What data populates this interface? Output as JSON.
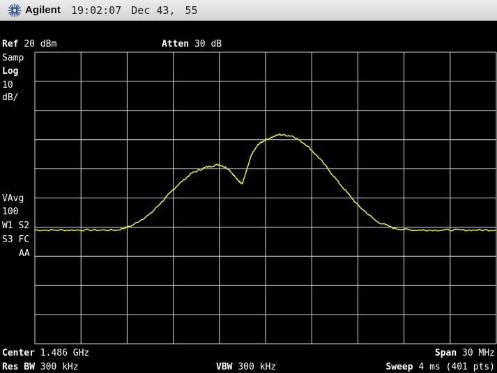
{
  "header": {
    "brand": "Agilent",
    "time": "19:02:07",
    "date": "Dec 43,",
    "extra": "55"
  },
  "display": {
    "ref_label": "Ref",
    "ref_value": "20 dBm",
    "atten_label": "Atten",
    "atten_value": "30 dB",
    "left_panel": {
      "mode": "Samp",
      "scale_type": "Log",
      "scale_value": "10",
      "scale_unit": "dB/",
      "avg_label": "VAvg",
      "avg_count": "100",
      "w1s2": "W1  S2",
      "s3fc": "S3  FC",
      "aa": "AA"
    },
    "center_label": "Center",
    "center_value": "1.486 GHz",
    "span_label": "Span",
    "span_value": "30 MHz",
    "rbw_label": "Res BW",
    "rbw_value": "300 kHz",
    "vbw_label": "VBW",
    "vbw_value": "300 kHz",
    "sweep_label": "Sweep",
    "sweep_value": "4 ms (401 pts)"
  },
  "colors": {
    "trace": "#e4e33a",
    "grid": "#d8d8d8",
    "background": "#000000"
  },
  "chart_data": {
    "type": "line",
    "ylim": [
      -80,
      20
    ],
    "xlim": [
      0,
      10
    ],
    "grid": true,
    "x": [
      0,
      0.6,
      1.2,
      1.8,
      2.1,
      2.5,
      2.8,
      3.1,
      3.4,
      3.7,
      4.0,
      4.2,
      4.4,
      4.5,
      4.6,
      4.7,
      4.85,
      5.0,
      5.3,
      5.6,
      5.9,
      6.2,
      6.6,
      7.0,
      7.4,
      7.8,
      8.2,
      8.5,
      9.0,
      9.5,
      10
    ],
    "y": [
      -41,
      -41,
      -41,
      -41,
      -39.5,
      -35.5,
      -30.5,
      -25.5,
      -21.5,
      -19.5,
      -18.5,
      -20,
      -24,
      -25,
      -20,
      -15,
      -11.5,
      -10,
      -8.2,
      -8.8,
      -12,
      -17,
      -25,
      -32.5,
      -38,
      -40.5,
      -41,
      -41,
      -41,
      -41,
      -41
    ]
  }
}
